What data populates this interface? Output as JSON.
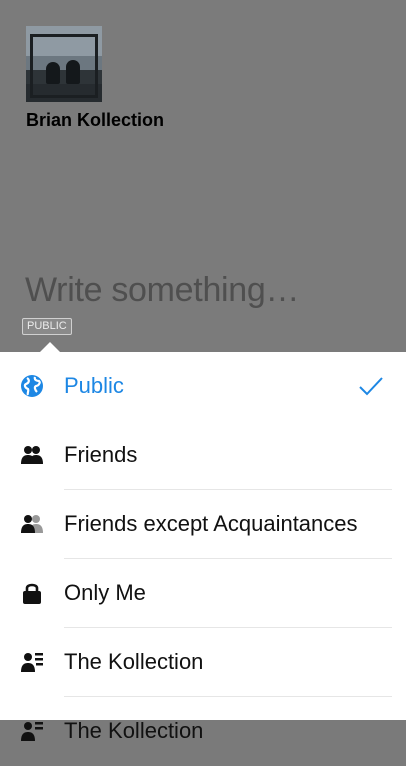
{
  "composer": {
    "user_name": "Brian Kollection",
    "placeholder": "Write something…",
    "audience_badge": "PUBLIC"
  },
  "audience_menu": {
    "items": [
      {
        "label": "Public",
        "icon": "globe-icon",
        "selected": true
      },
      {
        "label": "Friends",
        "icon": "friends-icon",
        "selected": false
      },
      {
        "label": "Friends except Acquaintances",
        "icon": "friends-except-icon",
        "selected": false
      },
      {
        "label": "Only Me",
        "icon": "lock-icon",
        "selected": false
      },
      {
        "label": "The Kollection",
        "icon": "list-icon",
        "selected": false
      },
      {
        "label": "The Kollection",
        "icon": "list-icon",
        "selected": false
      }
    ]
  },
  "colors": {
    "accent": "#1d87e4",
    "overlay": "#7b7b7b"
  }
}
